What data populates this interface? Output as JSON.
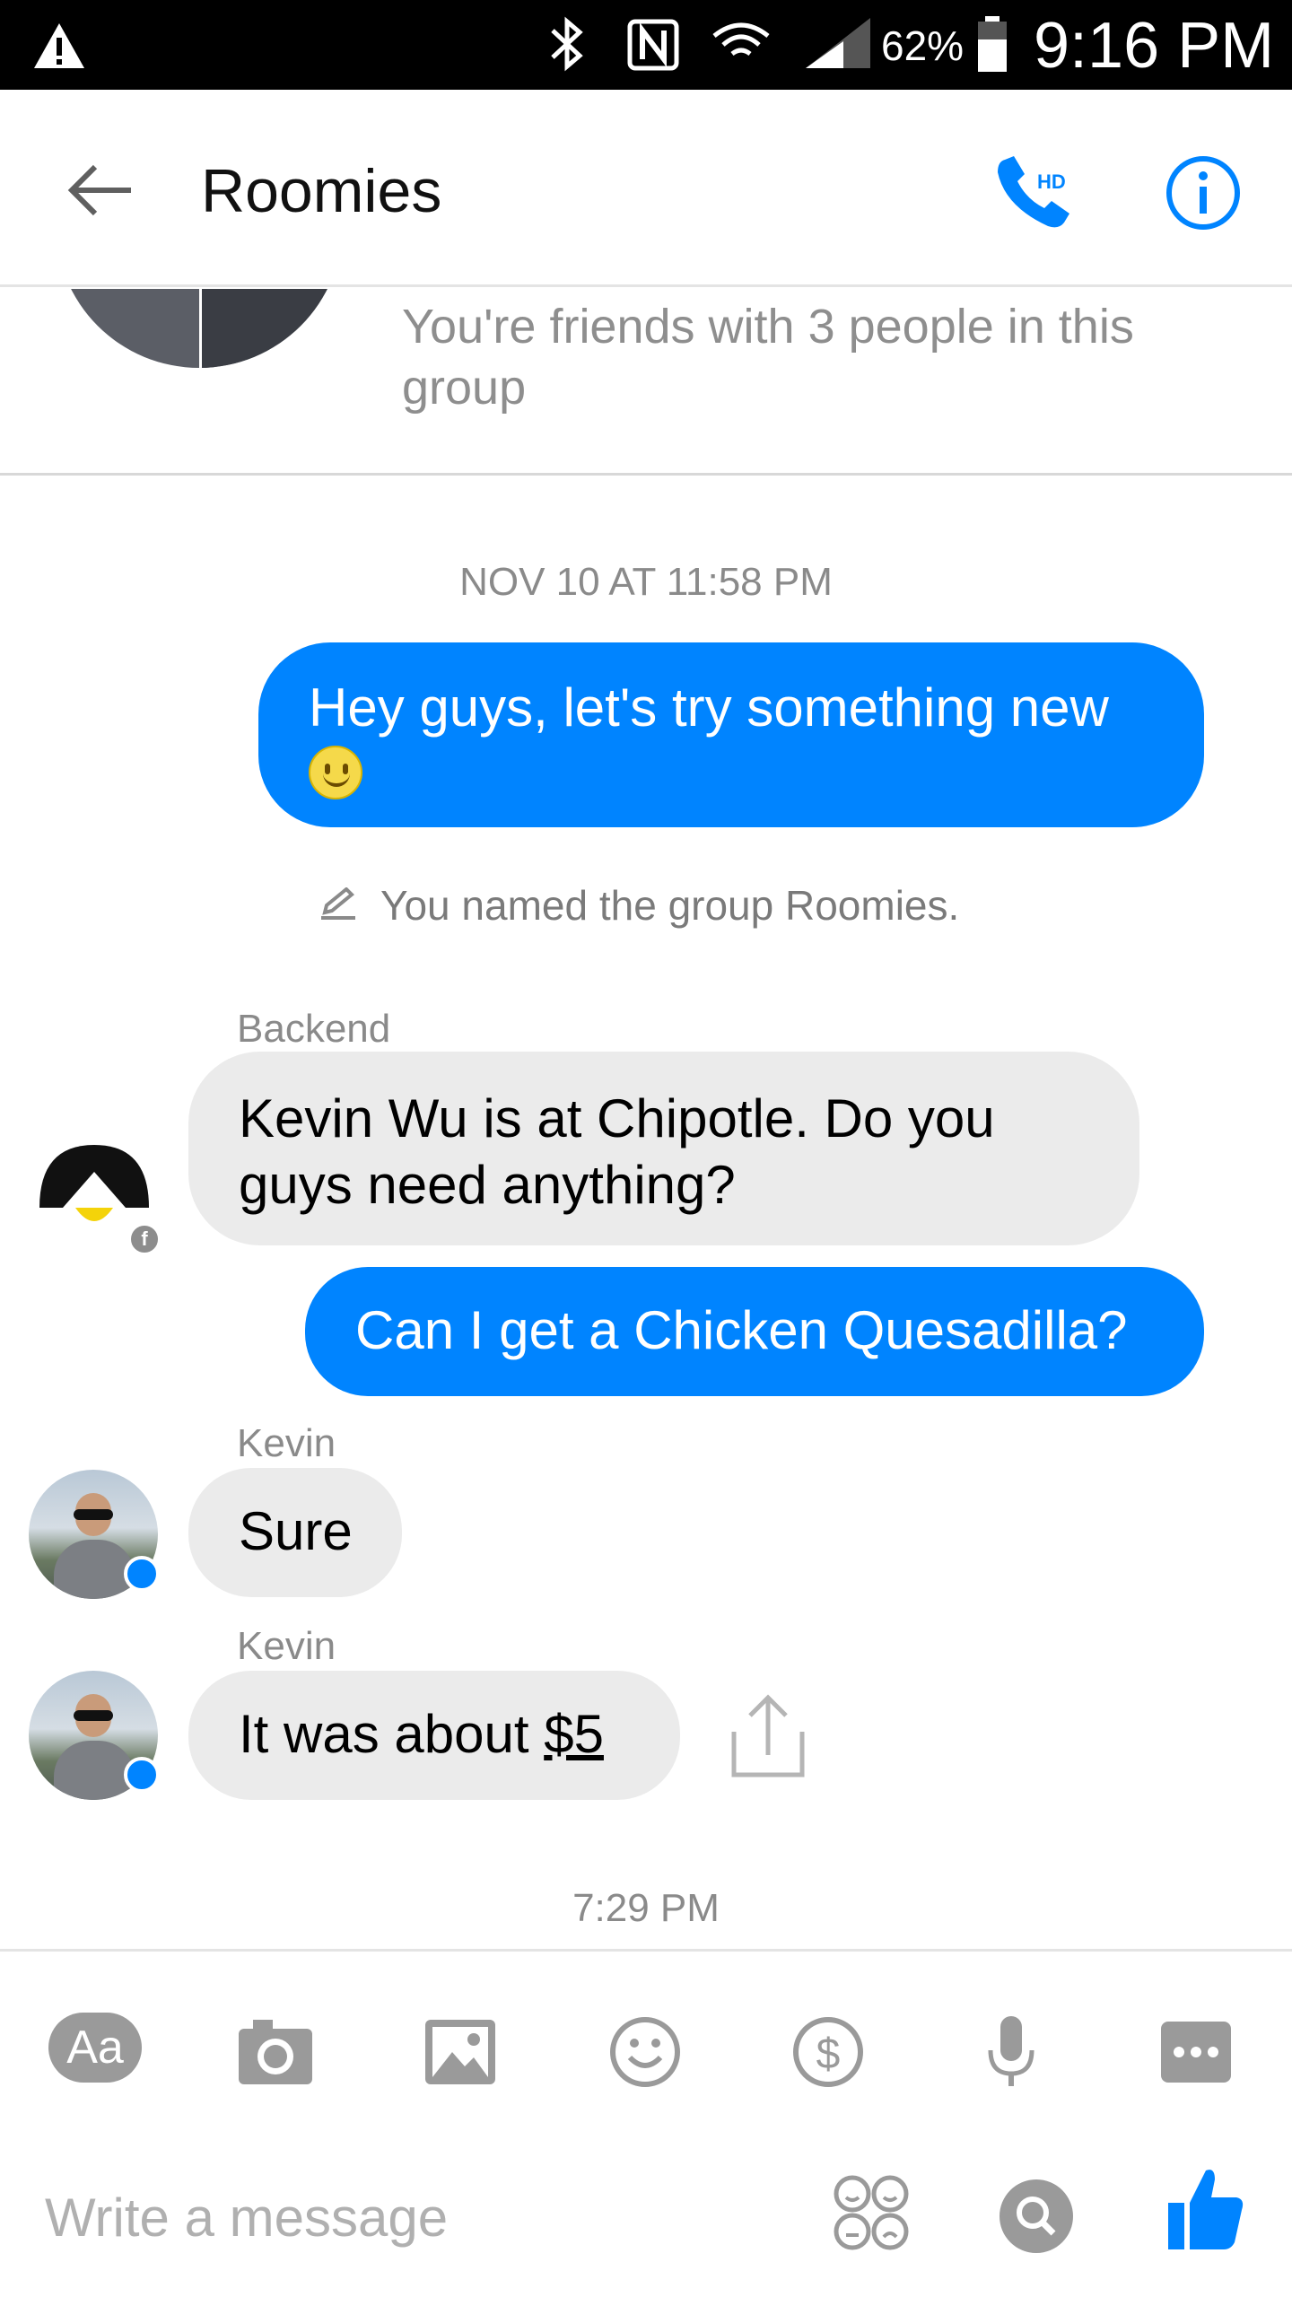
{
  "status_bar": {
    "battery_percent": "62%",
    "time": "9:16 PM",
    "icons": [
      "warning-icon",
      "bluetooth-icon",
      "nfc-icon",
      "wifi-icon",
      "signal-icon",
      "battery-icon"
    ]
  },
  "header": {
    "title": "Roomies",
    "call_badge": "HD",
    "icons": [
      "back-arrow-icon",
      "phone-hd-icon",
      "info-icon"
    ]
  },
  "intro": {
    "friends_note": "You're friends with 3 people in this group"
  },
  "thread": {
    "timestamp_1": "NOV 10 AT 11:58 PM",
    "msg_1": "Hey guys, let's try something new",
    "system_note": "You named the group Roomies.",
    "sender_backend": "Backend",
    "msg_2": "Kevin Wu is at Chipotle. Do you guys need anything?",
    "msg_3": "Can I get a Chicken Quesadilla?",
    "sender_kevin_1": "Kevin",
    "msg_4": "Sure",
    "sender_kevin_2": "Kevin",
    "msg_5_prefix": "It was about ",
    "msg_5_amount": "$5",
    "timestamp_2": "7:29 PM"
  },
  "composer": {
    "aa_label": "Aa",
    "placeholder": "Write a message",
    "colors": {
      "accent": "#0084ff",
      "tool_gray": "#9a9a9a"
    }
  }
}
